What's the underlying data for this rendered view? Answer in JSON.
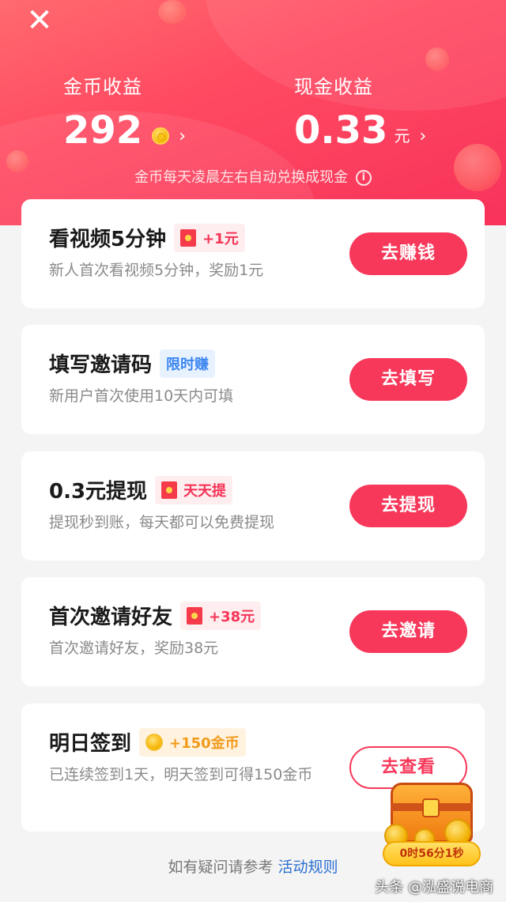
{
  "header": {
    "close_label": "✕",
    "coin_income": {
      "label": "金币收益",
      "value": "292",
      "arrow": "›"
    },
    "cash_income": {
      "label": "现金收益",
      "value": "0.33",
      "unit": "元",
      "arrow": "›"
    },
    "note": "金币每天凌晨左右自动兑换成现金",
    "info_glyph": "i"
  },
  "tasks": [
    {
      "title": "看视频5分钟",
      "badge": "+1元",
      "badge_icon": "red-envelope-icon",
      "desc": "新人首次看视频5分钟，奖励1元",
      "button": "去赚钱"
    },
    {
      "title": "填写邀请码",
      "badge": "限时赚",
      "desc": "新用户首次使用10天内可填",
      "button": "去填写"
    },
    {
      "title": "0.3元提现",
      "badge": "天天提",
      "badge_icon": "red-envelope-icon",
      "desc": "提现秒到账，每天都可以免费提现",
      "button": "去提现"
    },
    {
      "title": "首次邀请好友",
      "badge": "+38元",
      "badge_icon": "red-envelope-icon",
      "desc": "首次邀请好友，奖励38元",
      "button": "去邀请"
    },
    {
      "title": "明日签到",
      "badge": "+150金币",
      "badge_icon": "gold-coin-icon",
      "desc": "已连续签到1天，明天签到可得150金币",
      "button": "去查看"
    }
  ],
  "footer": {
    "text": "如有疑问请参考",
    "link": "活动规则"
  },
  "chest": {
    "timer": "0时56分1秒"
  },
  "watermark": "头条 @泓盛说电商",
  "colors": {
    "accent": "#f7385a",
    "header_top": "#ff6a6e",
    "header_bottom": "#f8325a",
    "link": "#2b6fd1"
  }
}
